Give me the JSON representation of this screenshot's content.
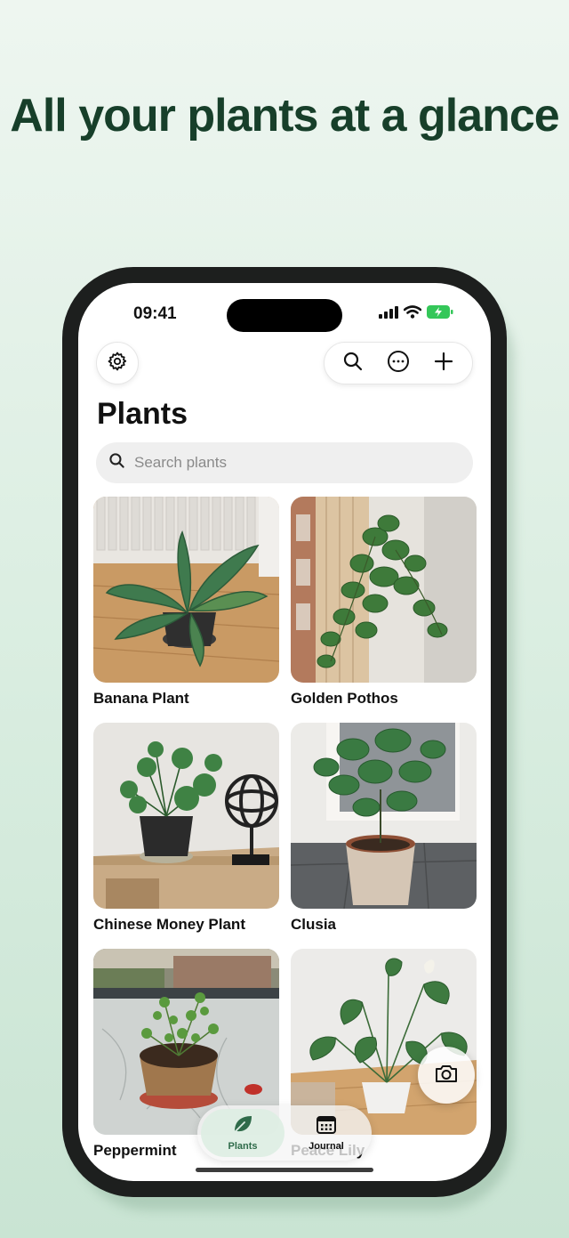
{
  "headline": "All your plants at a glance",
  "status_bar": {
    "time": "09:41"
  },
  "header": {
    "title": "Plants",
    "settings_icon": "gear-icon",
    "actions": [
      "search-icon",
      "more-icon",
      "plus-icon"
    ]
  },
  "search": {
    "placeholder": "Search plants",
    "value": ""
  },
  "plants": [
    {
      "name": "Banana Plant"
    },
    {
      "name": "Golden Pothos"
    },
    {
      "name": "Chinese Money Plant"
    },
    {
      "name": "Clusia"
    },
    {
      "name": "Peppermint"
    },
    {
      "name": "Peace Lily"
    }
  ],
  "tabbar": {
    "tabs": [
      {
        "label": "Plants",
        "icon": "leaf-icon",
        "active": true
      },
      {
        "label": "Journal",
        "icon": "calendar-icon",
        "active": false
      }
    ]
  },
  "fab": {
    "icon": "camera-icon"
  },
  "colors": {
    "accent": "#2f6b4a",
    "headline": "#173f2a",
    "battery": "#34c759"
  }
}
